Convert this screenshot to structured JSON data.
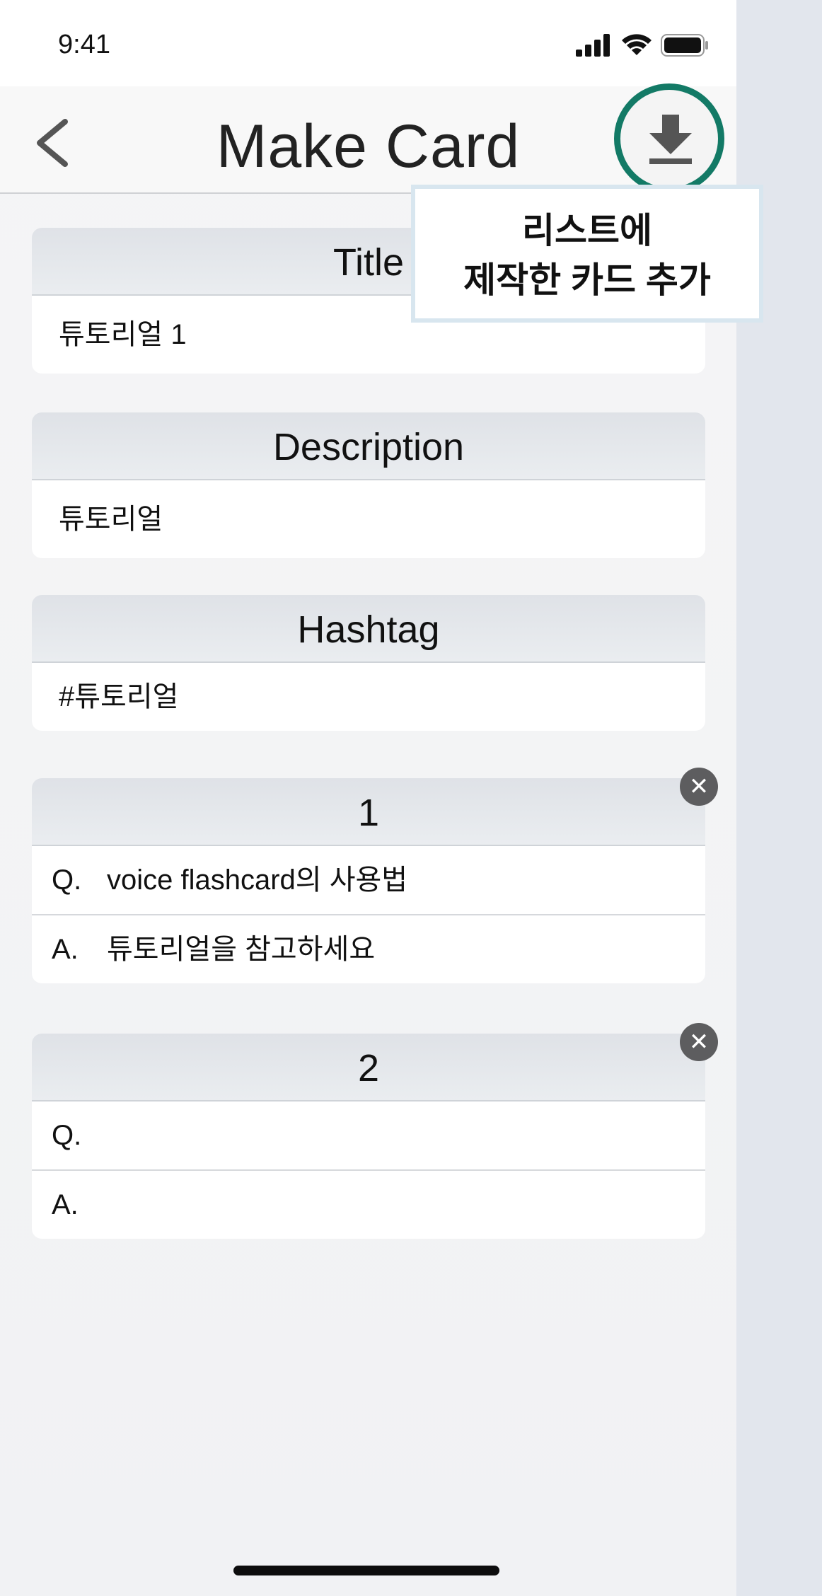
{
  "status_bar": {
    "time": "9:41"
  },
  "nav": {
    "title": "Make Card"
  },
  "tooltip": {
    "line1": "리스트에",
    "line2": "제작한 카드 추가"
  },
  "fields": {
    "title": {
      "label": "Title",
      "value": "튜토리얼 1"
    },
    "description": {
      "label": "Description",
      "value": "튜토리얼"
    },
    "hashtag": {
      "label": "Hashtag",
      "value": "#튜토리얼"
    }
  },
  "cards": [
    {
      "number": "1",
      "q_prefix": "Q.",
      "question": "voice flashcard의 사용법",
      "a_prefix": "A.",
      "answer": "튜토리얼을 참고하세요"
    },
    {
      "number": "2",
      "q_prefix": "Q.",
      "question": "",
      "a_prefix": "A.",
      "answer": ""
    }
  ],
  "icons": {
    "back": "chevron-left-icon",
    "download": "download-icon",
    "remove": "close-icon",
    "signal": "cellular-signal-icon",
    "wifi": "wifi-icon",
    "battery": "battery-icon"
  },
  "colors": {
    "accent_ring": "#137a66",
    "tooltip_border": "#d8e6ef",
    "remove_button": "#5d5d5f"
  }
}
